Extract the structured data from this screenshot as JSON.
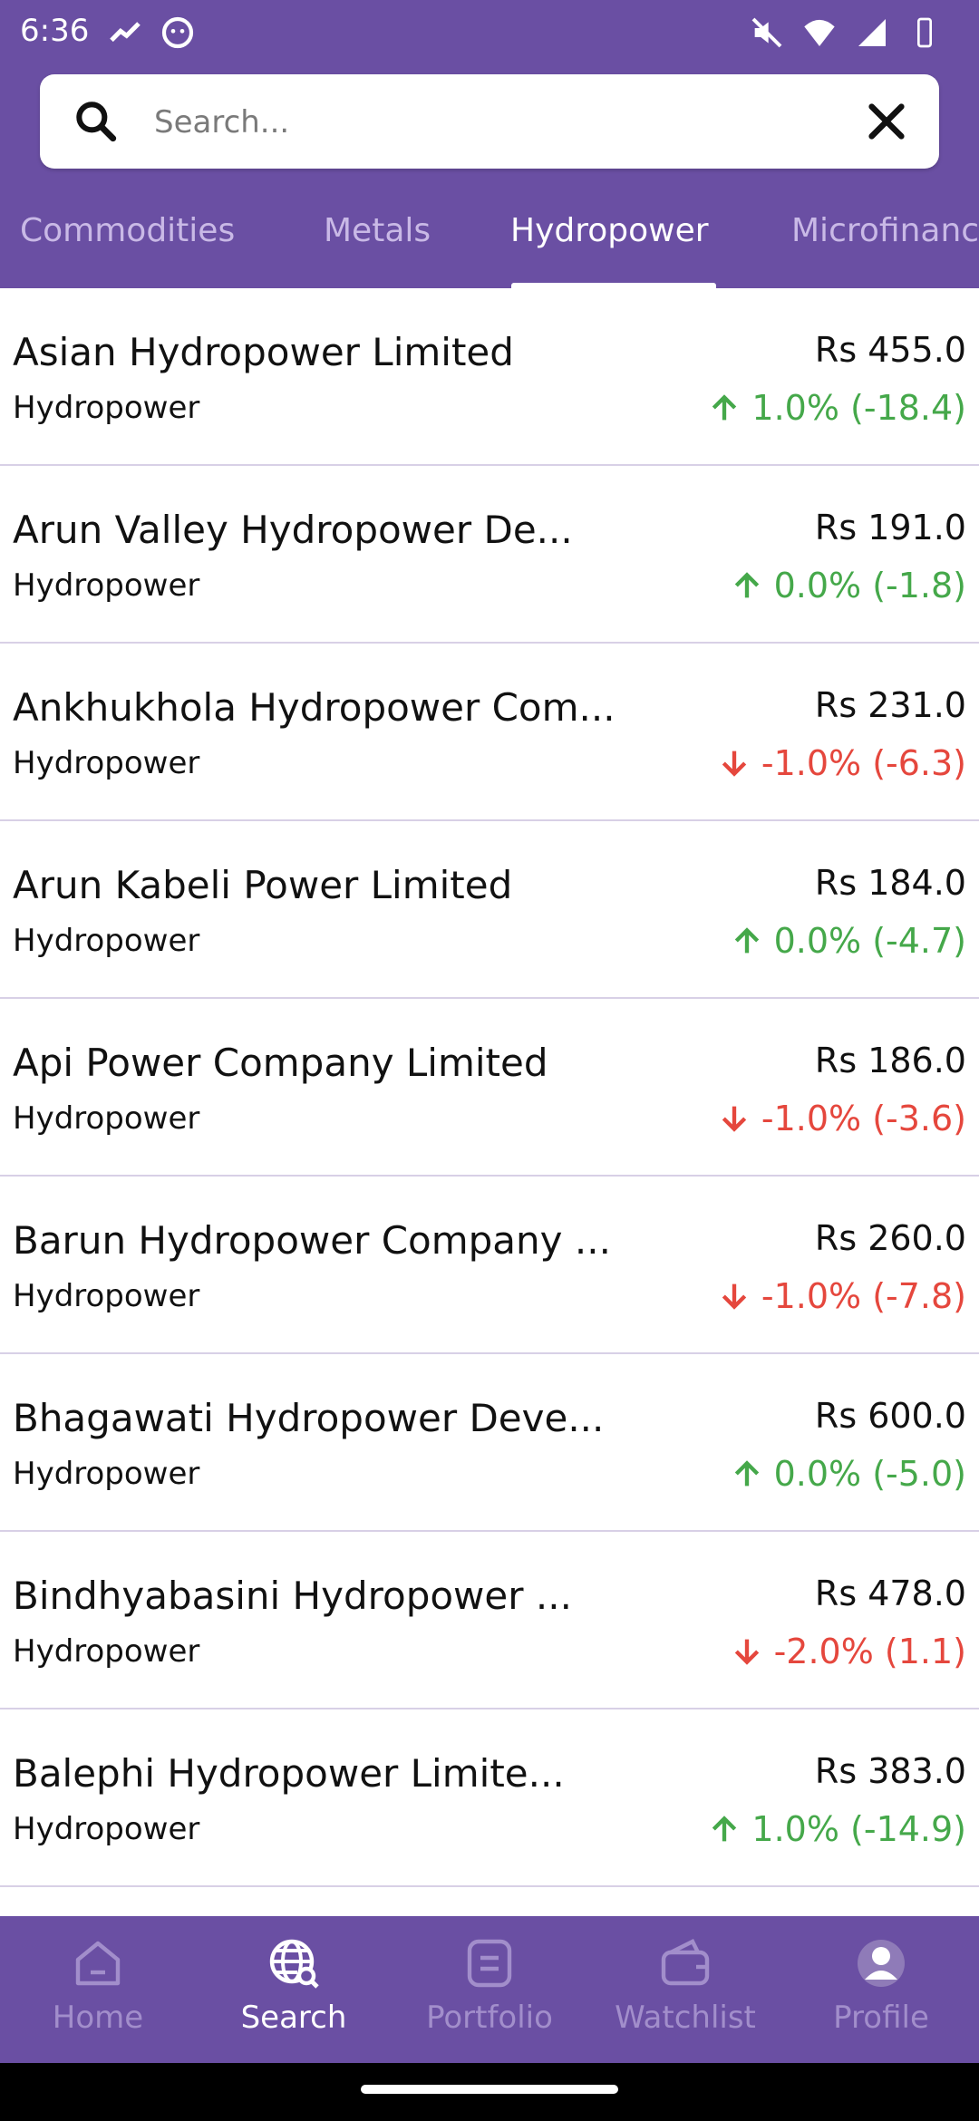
{
  "status": {
    "time": "6:36"
  },
  "search": {
    "placeholder": "Search..."
  },
  "tabs": [
    {
      "label": "Commodities"
    },
    {
      "label": "Metals"
    },
    {
      "label": "Hydropower"
    },
    {
      "label": "Microfinanc"
    }
  ],
  "stocks": [
    {
      "name": "Asian Hydropower Limited",
      "sector": "Hydropower",
      "price": "Rs 455.0",
      "change": "1.0% (-18.4)",
      "direction": "up"
    },
    {
      "name": "Arun Valley Hydropower De...",
      "sector": "Hydropower",
      "price": "Rs 191.0",
      "change": "0.0% (-1.8)",
      "direction": "up"
    },
    {
      "name": "Ankhukhola Hydropower Com...",
      "sector": "Hydropower",
      "price": "Rs 231.0",
      "change": "-1.0% (-6.3)",
      "direction": "down"
    },
    {
      "name": "Arun Kabeli Power Limited",
      "sector": "Hydropower",
      "price": "Rs 184.0",
      "change": "0.0% (-4.7)",
      "direction": "up"
    },
    {
      "name": "Api Power Company Limited",
      "sector": "Hydropower",
      "price": "Rs 186.0",
      "change": "-1.0% (-3.6)",
      "direction": "down"
    },
    {
      "name": "Barun Hydropower Company ...",
      "sector": "Hydropower",
      "price": "Rs 260.0",
      "change": "-1.0% (-7.8)",
      "direction": "down"
    },
    {
      "name": "Bhagawati Hydropower Deve...",
      "sector": "Hydropower",
      "price": "Rs 600.0",
      "change": "0.0% (-5.0)",
      "direction": "up"
    },
    {
      "name": "Bindhyabasini Hydropower ...",
      "sector": "Hydropower",
      "price": "Rs 478.0",
      "change": "-2.0% (1.1)",
      "direction": "down"
    },
    {
      "name": "Balephi Hydropower Limite...",
      "sector": "Hydropower",
      "price": "Rs 383.0",
      "change": "1.0% (-14.9)",
      "direction": "up"
    }
  ],
  "nav": [
    {
      "label": "Home",
      "icon": "home-icon"
    },
    {
      "label": "Search",
      "icon": "globe-search-icon"
    },
    {
      "label": "Portfolio",
      "icon": "portfolio-icon"
    },
    {
      "label": "Watchlist",
      "icon": "wallet-icon"
    },
    {
      "label": "Profile",
      "icon": "profile-icon"
    }
  ],
  "colors": {
    "primary": "#6a4fa3",
    "up": "#45a84a",
    "down": "#e5473d",
    "tab_inactive": "#c9b9e6",
    "nav_inactive": "#a28ecb"
  }
}
